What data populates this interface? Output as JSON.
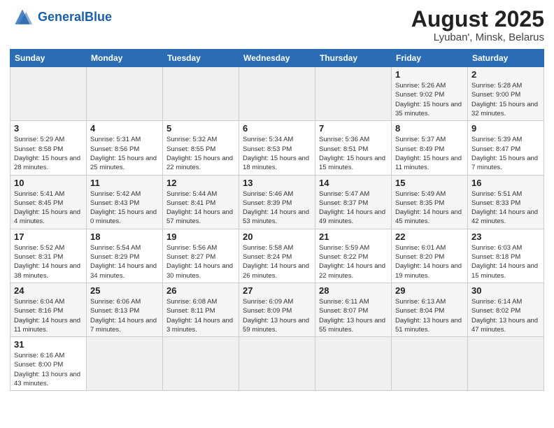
{
  "header": {
    "logo_general": "General",
    "logo_blue": "Blue",
    "title": "August 2025",
    "subtitle": "Lyuban', Minsk, Belarus"
  },
  "calendar": {
    "days_of_week": [
      "Sunday",
      "Monday",
      "Tuesday",
      "Wednesday",
      "Thursday",
      "Friday",
      "Saturday"
    ],
    "rows": [
      {
        "cells": [
          {
            "num": "",
            "info": ""
          },
          {
            "num": "",
            "info": ""
          },
          {
            "num": "",
            "info": ""
          },
          {
            "num": "",
            "info": ""
          },
          {
            "num": "",
            "info": ""
          },
          {
            "num": "1",
            "info": "Sunrise: 5:26 AM\nSunset: 9:02 PM\nDaylight: 15 hours\nand 35 minutes."
          },
          {
            "num": "2",
            "info": "Sunrise: 5:28 AM\nSunset: 9:00 PM\nDaylight: 15 hours\nand 32 minutes."
          }
        ]
      },
      {
        "cells": [
          {
            "num": "3",
            "info": "Sunrise: 5:29 AM\nSunset: 8:58 PM\nDaylight: 15 hours\nand 28 minutes."
          },
          {
            "num": "4",
            "info": "Sunrise: 5:31 AM\nSunset: 8:56 PM\nDaylight: 15 hours\nand 25 minutes."
          },
          {
            "num": "5",
            "info": "Sunrise: 5:32 AM\nSunset: 8:55 PM\nDaylight: 15 hours\nand 22 minutes."
          },
          {
            "num": "6",
            "info": "Sunrise: 5:34 AM\nSunset: 8:53 PM\nDaylight: 15 hours\nand 18 minutes."
          },
          {
            "num": "7",
            "info": "Sunrise: 5:36 AM\nSunset: 8:51 PM\nDaylight: 15 hours\nand 15 minutes."
          },
          {
            "num": "8",
            "info": "Sunrise: 5:37 AM\nSunset: 8:49 PM\nDaylight: 15 hours\nand 11 minutes."
          },
          {
            "num": "9",
            "info": "Sunrise: 5:39 AM\nSunset: 8:47 PM\nDaylight: 15 hours\nand 7 minutes."
          }
        ]
      },
      {
        "cells": [
          {
            "num": "10",
            "info": "Sunrise: 5:41 AM\nSunset: 8:45 PM\nDaylight: 15 hours\nand 4 minutes."
          },
          {
            "num": "11",
            "info": "Sunrise: 5:42 AM\nSunset: 8:43 PM\nDaylight: 15 hours\nand 0 minutes."
          },
          {
            "num": "12",
            "info": "Sunrise: 5:44 AM\nSunset: 8:41 PM\nDaylight: 14 hours\nand 57 minutes."
          },
          {
            "num": "13",
            "info": "Sunrise: 5:46 AM\nSunset: 8:39 PM\nDaylight: 14 hours\nand 53 minutes."
          },
          {
            "num": "14",
            "info": "Sunrise: 5:47 AM\nSunset: 8:37 PM\nDaylight: 14 hours\nand 49 minutes."
          },
          {
            "num": "15",
            "info": "Sunrise: 5:49 AM\nSunset: 8:35 PM\nDaylight: 14 hours\nand 45 minutes."
          },
          {
            "num": "16",
            "info": "Sunrise: 5:51 AM\nSunset: 8:33 PM\nDaylight: 14 hours\nand 42 minutes."
          }
        ]
      },
      {
        "cells": [
          {
            "num": "17",
            "info": "Sunrise: 5:52 AM\nSunset: 8:31 PM\nDaylight: 14 hours\nand 38 minutes."
          },
          {
            "num": "18",
            "info": "Sunrise: 5:54 AM\nSunset: 8:29 PM\nDaylight: 14 hours\nand 34 minutes."
          },
          {
            "num": "19",
            "info": "Sunrise: 5:56 AM\nSunset: 8:27 PM\nDaylight: 14 hours\nand 30 minutes."
          },
          {
            "num": "20",
            "info": "Sunrise: 5:58 AM\nSunset: 8:24 PM\nDaylight: 14 hours\nand 26 minutes."
          },
          {
            "num": "21",
            "info": "Sunrise: 5:59 AM\nSunset: 8:22 PM\nDaylight: 14 hours\nand 22 minutes."
          },
          {
            "num": "22",
            "info": "Sunrise: 6:01 AM\nSunset: 8:20 PM\nDaylight: 14 hours\nand 19 minutes."
          },
          {
            "num": "23",
            "info": "Sunrise: 6:03 AM\nSunset: 8:18 PM\nDaylight: 14 hours\nand 15 minutes."
          }
        ]
      },
      {
        "cells": [
          {
            "num": "24",
            "info": "Sunrise: 6:04 AM\nSunset: 8:16 PM\nDaylight: 14 hours\nand 11 minutes."
          },
          {
            "num": "25",
            "info": "Sunrise: 6:06 AM\nSunset: 8:13 PM\nDaylight: 14 hours\nand 7 minutes."
          },
          {
            "num": "26",
            "info": "Sunrise: 6:08 AM\nSunset: 8:11 PM\nDaylight: 14 hours\nand 3 minutes."
          },
          {
            "num": "27",
            "info": "Sunrise: 6:09 AM\nSunset: 8:09 PM\nDaylight: 13 hours\nand 59 minutes."
          },
          {
            "num": "28",
            "info": "Sunrise: 6:11 AM\nSunset: 8:07 PM\nDaylight: 13 hours\nand 55 minutes."
          },
          {
            "num": "29",
            "info": "Sunrise: 6:13 AM\nSunset: 8:04 PM\nDaylight: 13 hours\nand 51 minutes."
          },
          {
            "num": "30",
            "info": "Sunrise: 6:14 AM\nSunset: 8:02 PM\nDaylight: 13 hours\nand 47 minutes."
          }
        ]
      },
      {
        "cells": [
          {
            "num": "31",
            "info": "Sunrise: 6:16 AM\nSunset: 8:00 PM\nDaylight: 13 hours\nand 43 minutes."
          },
          {
            "num": "",
            "info": ""
          },
          {
            "num": "",
            "info": ""
          },
          {
            "num": "",
            "info": ""
          },
          {
            "num": "",
            "info": ""
          },
          {
            "num": "",
            "info": ""
          },
          {
            "num": "",
            "info": ""
          }
        ]
      }
    ]
  }
}
